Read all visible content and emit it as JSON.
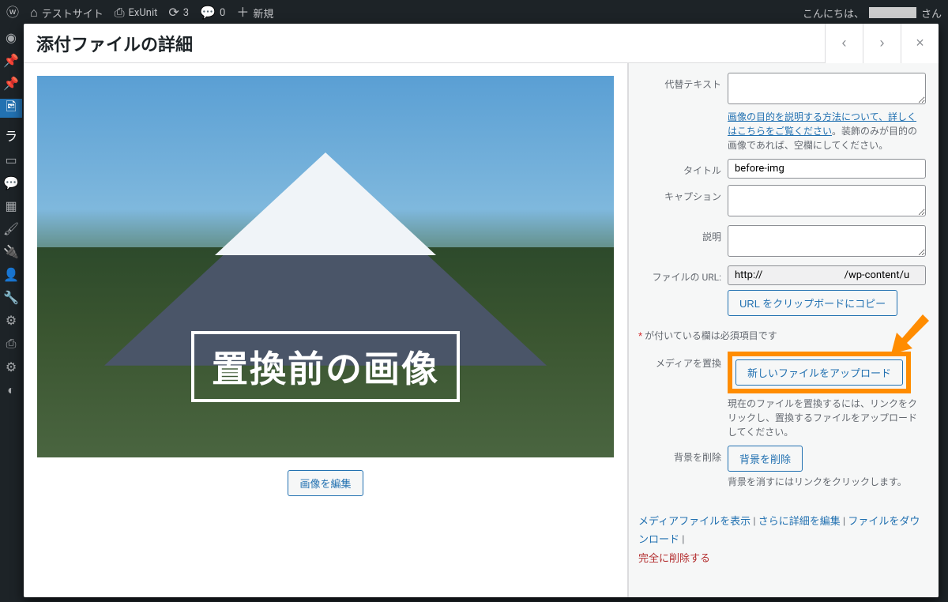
{
  "adminbar": {
    "site_name": "テストサイト",
    "exunit": "ExUnit",
    "comments": "0",
    "updates": "3",
    "new": "新規",
    "greeting": "こんにちは、",
    "greeting_suffix": "さん"
  },
  "modal": {
    "title": "添付ファイルの詳細",
    "prev": "‹",
    "next": "›",
    "close": "×"
  },
  "image": {
    "caption_overlay": "置換前の画像",
    "edit_button": "画像を編集"
  },
  "fields": {
    "alt_label": "代替テキスト",
    "alt_help_link": "画像の目的を説明する方法について、詳しくはこちらをご覧ください",
    "alt_help_rest": "。装飾のみが目的の画像であれば、空欄にしてください。",
    "title_label": "タイトル",
    "title_value": "before-img",
    "caption_label": "キャプション",
    "desc_label": "説明",
    "url_label": "ファイルの URL:",
    "url_value": "http://                                /wp-content/u",
    "copy_url": "URL をクリップボードにコピー",
    "required_note_prefix": "*",
    "required_note": " が付いている欄は必須項目です",
    "replace_label": "メディアを置換",
    "replace_button": "新しいファイルをアップロード",
    "replace_help": "現在のファイルを置換するには、リンクをクリックし、置換するファイルをアップロードしてください。",
    "removebg_label": "背景を削除",
    "removebg_button": "背景を削除",
    "removebg_help": "背景を消すにはリンクをクリックします。"
  },
  "actions": {
    "view": "メディアファイルを表示",
    "edit_more": "さらに詳細を編集",
    "download": "ファイルをダウンロード",
    "delete": "完全に削除する"
  }
}
